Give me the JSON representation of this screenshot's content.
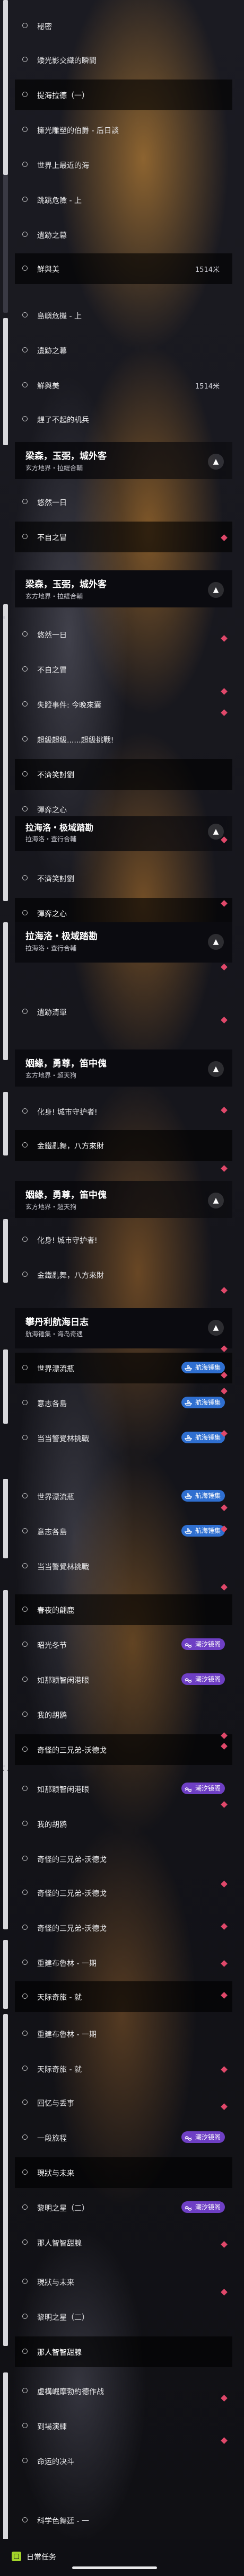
{
  "rows": [
    {
      "label": "秘密"
    },
    {
      "label": "矮光影交織的瞬間"
    },
    {
      "label": "提海拉德（一）"
    },
    {
      "label": "擁光雕塑的伯爵 - 后日談"
    },
    {
      "label": "世界上最近的海"
    },
    {
      "label": "跳跳危險 - 上"
    },
    {
      "label": "遺跡之幕"
    },
    {
      "label": "鮮與美",
      "value": "1514米"
    },
    {
      "label": "島嶼危機 - 上"
    },
    {
      "label": "遺跡之幕"
    },
    {
      "label": "鮮與美",
      "value": "1514米"
    },
    {
      "label": "趕了不起的机兵"
    },
    {
      "label": "悠然一日"
    },
    {
      "label": "不自之冒"
    },
    {
      "label": "悠然一日"
    },
    {
      "label": "不自之冒"
    },
    {
      "label": "失蹤事件: 今晚來囊"
    },
    {
      "label": "超級超級......超級挑戰!"
    },
    {
      "label": "不濟笑討劉"
    },
    {
      "label": "彈弈之心"
    },
    {
      "label": "不濟笑討劉"
    },
    {
      "label": "彈弈之心"
    },
    {
      "label": "遺跡清單"
    },
    {
      "label": "化身! 城市守护者!"
    },
    {
      "label": "金鐵亂舞，八方來財"
    },
    {
      "label": "化身! 城市守护者!"
    },
    {
      "label": "金鐵亂舞，八方來財"
    },
    {
      "label": "世界漂流瓶"
    },
    {
      "label": "意志各島"
    },
    {
      "label": "当当警覺林挑戰"
    },
    {
      "label": "世界漂流瓶"
    },
    {
      "label": "意志各島"
    },
    {
      "label": "当当警覺林挑戰"
    },
    {
      "label": "春夜的翩鹿"
    },
    {
      "label": "昭光冬节"
    },
    {
      "label": "如那颖智闲港眼"
    },
    {
      "label": "我的胡鸥"
    },
    {
      "label": "奇怪的三兄弟-沃德戈"
    },
    {
      "label": "如那颖智闲港眼"
    },
    {
      "label": "我的胡鸥"
    },
    {
      "label": "奇怪的三兄弟-沃德戈"
    },
    {
      "label": "奇怪的三兄弟-沃德戈"
    },
    {
      "label": "奇怪的三兄弟-沃德戈"
    },
    {
      "label": "重建布魯林 - 一期"
    },
    {
      "label": "天际奇旅 - 就"
    },
    {
      "label": "重建布魯林 - 一期"
    },
    {
      "label": "天际奇旅 - 就"
    },
    {
      "label": "回忆与丢事"
    },
    {
      "label": "一段旅程"
    },
    {
      "label": "現狀与未来"
    },
    {
      "label": "黎明之星（二）"
    },
    {
      "label": "那人智智甜腺"
    },
    {
      "label": "現狀与未来"
    },
    {
      "label": "黎明之星（二）"
    },
    {
      "label": "那人智智甜腺"
    },
    {
      "label": "虚構崛摩勃約德作战"
    },
    {
      "label": "到場演練"
    },
    {
      "label": "命运的决斗"
    },
    {
      "label": "科学色舞廷 - 一"
    }
  ],
  "headers": [
    {
      "title": "梁森，玉弼，城外客",
      "sub": "玄方地界・拉緹合輔"
    },
    {
      "title": "梁森，玉弼，城外客",
      "sub": "玄方地界・拉緹合輔"
    },
    {
      "title": "拉海洛・极域踏勘",
      "sub": "拉海洛・查行合輔"
    },
    {
      "title": "拉海洛・极域踏勘",
      "sub": "拉海洛・查行合輔"
    },
    {
      "title": "姻緣，勇尊，笛中傀",
      "sub": "玄方地界・超天狗"
    },
    {
      "title": "姻緣，勇尊，笛中傀",
      "sub": "玄方地界・超天狗"
    },
    {
      "title": "攀丹利航海日志",
      "sub": "航海锤集・海岛奇遇"
    }
  ],
  "badges": {
    "blue_text": "航海锤集",
    "purple_text": "潮汐镜阁"
  },
  "tabbar": {
    "label": "日常任务"
  },
  "colors": {
    "blue_badge": "#2f6fd0",
    "purple_badge": "#6e3fc4",
    "diamond": "#e0486a",
    "tab_icon": "#a4d52a"
  }
}
